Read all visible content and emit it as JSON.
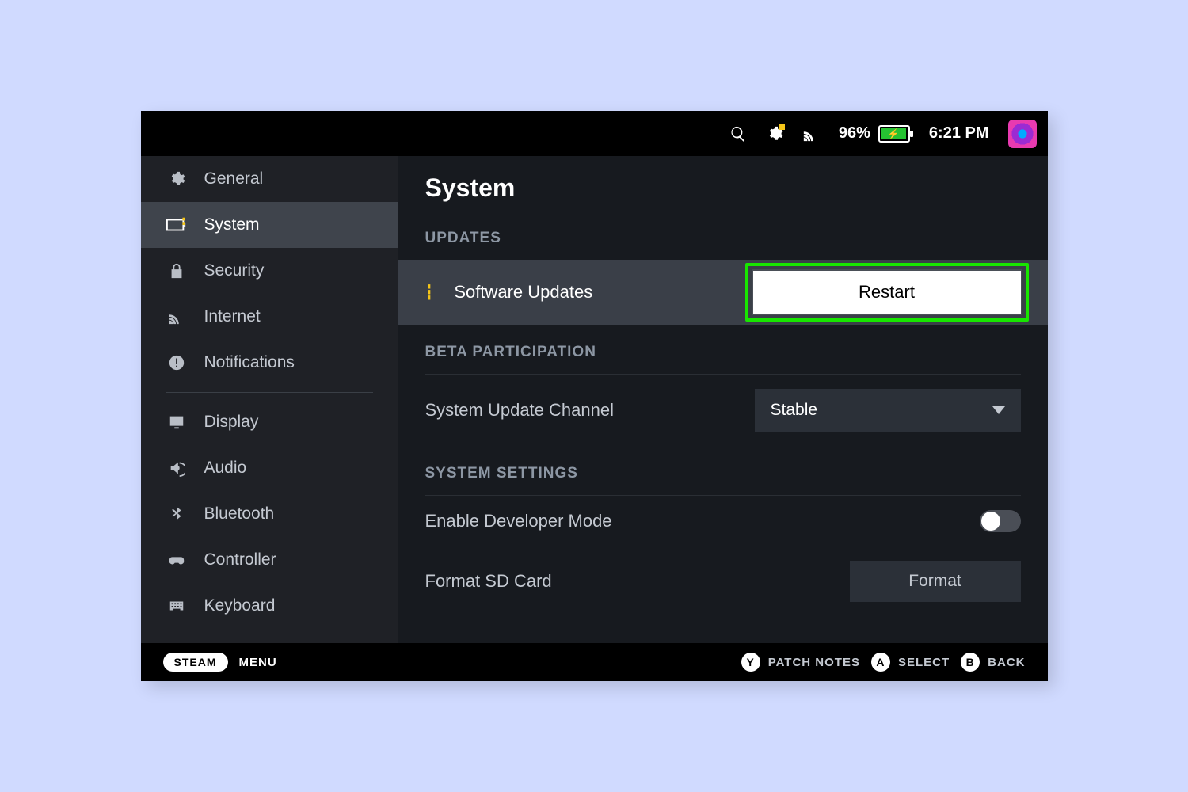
{
  "status": {
    "battery_percent": "96%",
    "clock": "6:21 PM"
  },
  "sidebar": {
    "items": [
      {
        "label": "General"
      },
      {
        "label": "System"
      },
      {
        "label": "Security"
      },
      {
        "label": "Internet"
      },
      {
        "label": "Notifications"
      },
      {
        "label": "Display"
      },
      {
        "label": "Audio"
      },
      {
        "label": "Bluetooth"
      },
      {
        "label": "Controller"
      },
      {
        "label": "Keyboard"
      }
    ]
  },
  "content": {
    "title": "System",
    "sections": {
      "updates": {
        "heading": "UPDATES",
        "row_label": "Software Updates",
        "button_label": "Restart"
      },
      "beta": {
        "heading": "BETA PARTICIPATION",
        "channel_label": "System Update Channel",
        "channel_value": "Stable"
      },
      "system_settings": {
        "heading": "SYSTEM SETTINGS",
        "dev_mode_label": "Enable Developer Mode",
        "format_label": "Format SD Card",
        "format_button": "Format"
      }
    }
  },
  "bottom": {
    "steam": "STEAM",
    "menu": "MENU",
    "y_key": "Y",
    "y_label": "PATCH NOTES",
    "a_key": "A",
    "a_label": "SELECT",
    "b_key": "B",
    "b_label": "BACK"
  }
}
